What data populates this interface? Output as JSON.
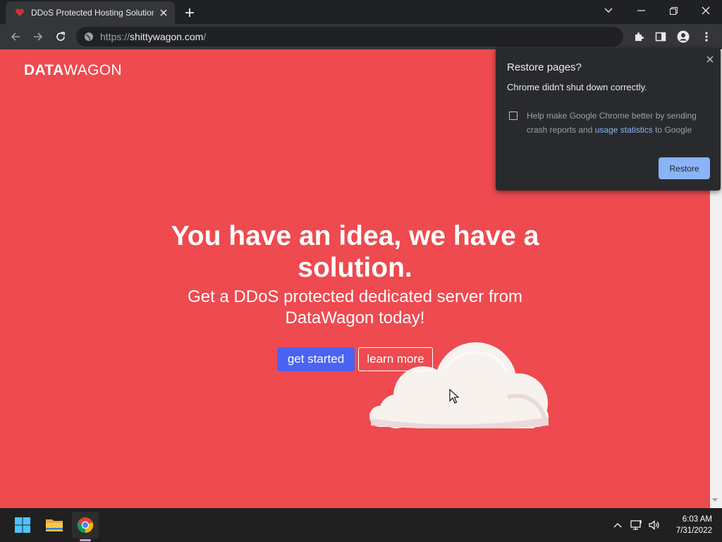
{
  "browser": {
    "tab": {
      "title": "DDoS Protected Hosting Solution",
      "favicon": "heart-shield-icon"
    },
    "url": {
      "scheme": "https://",
      "host": "shittywagon.com",
      "path": "/"
    }
  },
  "page": {
    "logo": {
      "bold": "DATA",
      "light": "WAGON"
    },
    "hero": {
      "title": "You have an idea, we have a solution.",
      "subtitle": "Get a DDoS protected dedicated server from DataWagon today!"
    },
    "buttons": {
      "primary": "get started",
      "secondary": "learn more"
    },
    "colors": {
      "background": "#ee4a4f",
      "primary_button": "#4a63f2"
    }
  },
  "restore_popup": {
    "title": "Restore pages?",
    "message": "Chrome didn't shut down correctly.",
    "help_prefix": "Help make Google Chrome better by sending crash reports and ",
    "help_link": "usage statistics",
    "help_suffix": " to Google",
    "checkbox_checked": false,
    "button": "Restore"
  },
  "taskbar": {
    "apps": [
      "windows-start-icon",
      "file-explorer-icon",
      "chrome-icon"
    ],
    "clock": {
      "time": "6:03 AM",
      "date": "7/31/2022"
    }
  }
}
